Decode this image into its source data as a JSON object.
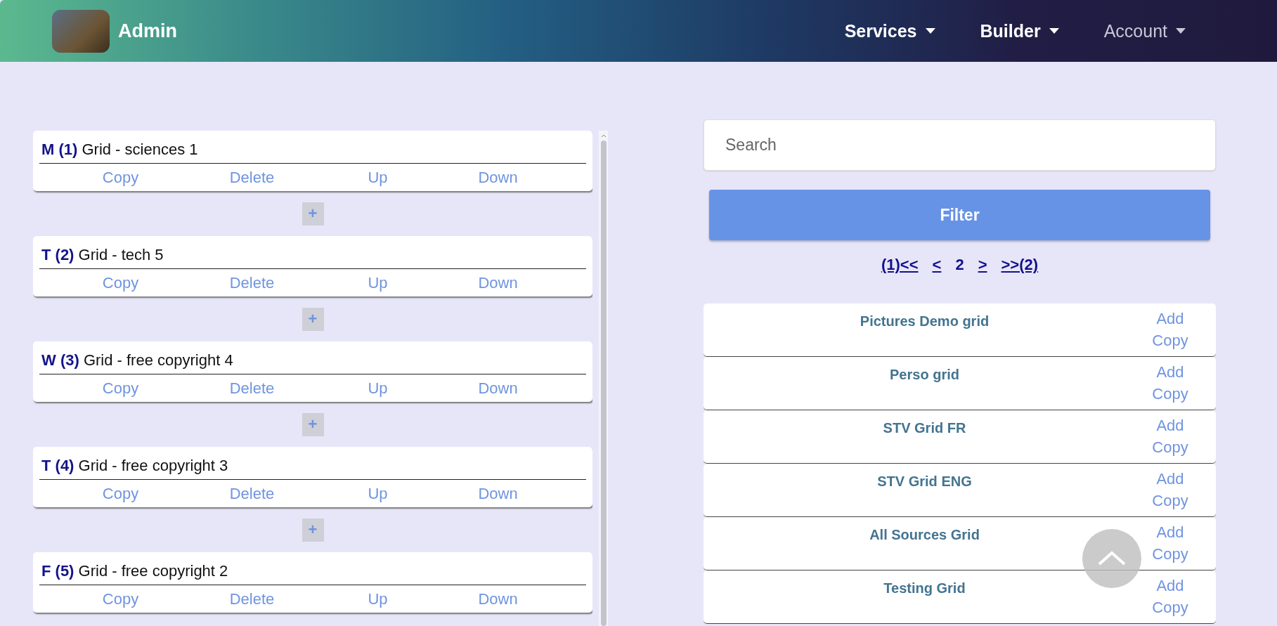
{
  "header": {
    "brand": "Admin",
    "nav": [
      {
        "label": "Services",
        "disabled": false
      },
      {
        "label": "Builder",
        "disabled": false
      },
      {
        "label": "Account",
        "disabled": true
      }
    ]
  },
  "grids": [
    {
      "letter": "M (1)",
      "title": "Grid - sciences 1",
      "actions": [
        "Copy",
        "Delete",
        "Up",
        "Down"
      ],
      "add": "+"
    },
    {
      "letter": "T (2)",
      "title": "Grid - tech 5",
      "actions": [
        "Copy",
        "Delete",
        "Up",
        "Down"
      ],
      "add": "+"
    },
    {
      "letter": "W (3)",
      "title": "Grid - free copyright 4",
      "actions": [
        "Copy",
        "Delete",
        "Up",
        "Down"
      ],
      "add": "+"
    },
    {
      "letter": "T (4)",
      "title": "Grid - free copyright 3",
      "actions": [
        "Copy",
        "Delete",
        "Up",
        "Down"
      ],
      "add": "+"
    },
    {
      "letter": "F (5)",
      "title": "Grid - free copyright 2",
      "actions": [
        "Copy",
        "Delete",
        "Up",
        "Down"
      ]
    }
  ],
  "search": {
    "placeholder": "Search"
  },
  "filter_button": "Filter",
  "pagination": [
    {
      "label": "(1)<<",
      "selected": false
    },
    {
      "label": "<",
      "selected": false
    },
    {
      "label": "2",
      "selected": true
    },
    {
      "label": ">",
      "selected": false
    },
    {
      "label": ">>(2)",
      "selected": false
    }
  ],
  "templates": [
    {
      "name": "Pictures Demo grid",
      "actions": [
        "Add",
        "Copy"
      ]
    },
    {
      "name": "Perso grid",
      "actions": [
        "Add",
        "Copy"
      ]
    },
    {
      "name": "STV Grid FR",
      "actions": [
        "Add",
        "Copy"
      ]
    },
    {
      "name": "STV Grid ENG",
      "actions": [
        "Add",
        "Copy"
      ]
    },
    {
      "name": "All Sources Grid",
      "actions": [
        "Add",
        "Copy"
      ]
    },
    {
      "name": "Testing Grid",
      "actions": [
        "Add",
        "Copy"
      ]
    }
  ]
}
